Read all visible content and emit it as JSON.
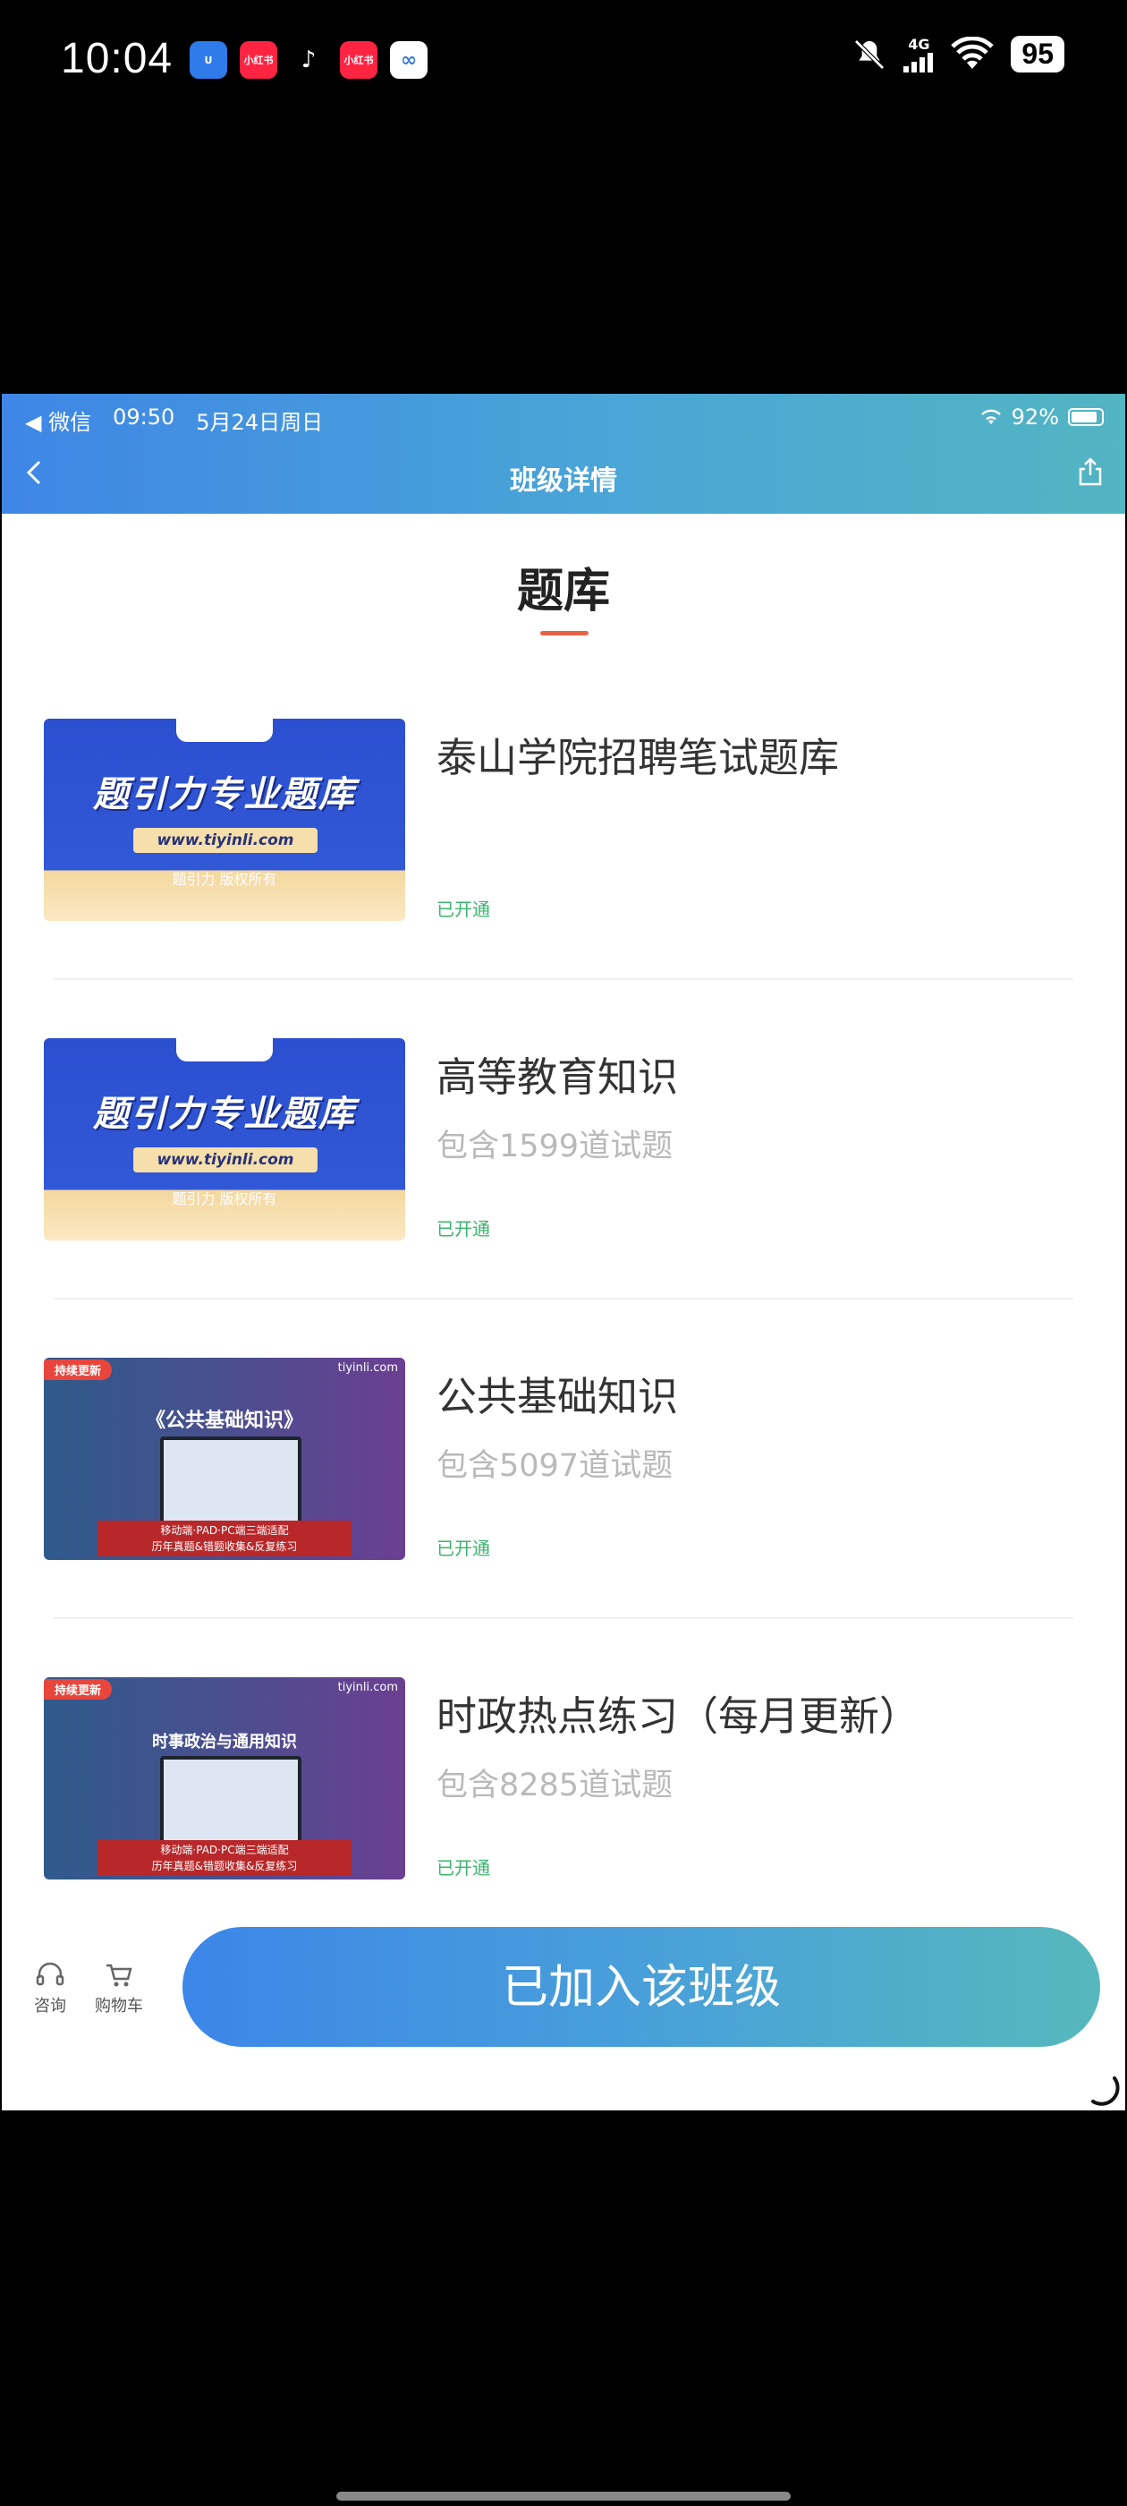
{
  "status_bar": {
    "time": "10:04",
    "network": "4G",
    "battery": "95"
  },
  "wechat_bar": {
    "back_label": "◀ 微信",
    "time": "09:50",
    "date": "5月24日周日",
    "battery": "92%"
  },
  "nav": {
    "title": "班级详情"
  },
  "section": {
    "title": "题库"
  },
  "thumbs": {
    "blue_title": "题引力专业题库",
    "blue_url": "www.tiyinli.com",
    "blue_owner": "题引力 版权所有",
    "badge": "持续更新",
    "brand": "tiyinli.com",
    "course3_title": "《公共基础知识》",
    "course4_title": "时事政治与通用知识",
    "footer_line1": "移动端·PAD·PC端三端适配",
    "footer_line2": "历年真题&错题收集&反复练习"
  },
  "items": [
    {
      "title": "泰山学院招聘笔试题库",
      "count": "",
      "status": "已开通"
    },
    {
      "title": "高等教育知识",
      "count": "包含1599道试题",
      "status": "已开通"
    },
    {
      "title": "公共基础知识",
      "count": "包含5097道试题",
      "status": "已开通"
    },
    {
      "title": "时政热点练习（每月更新）",
      "count": "包含8285道试题",
      "status": "已开通"
    }
  ],
  "bottom": {
    "consult_label": "咨询",
    "cart_label": "购物车",
    "cta_label": "已加入该班级"
  },
  "colors": {
    "accent_blue": "#3f86e6",
    "accent_teal": "#52b5c2",
    "status_green": "#3bb46e",
    "underline": "#e8624a"
  }
}
